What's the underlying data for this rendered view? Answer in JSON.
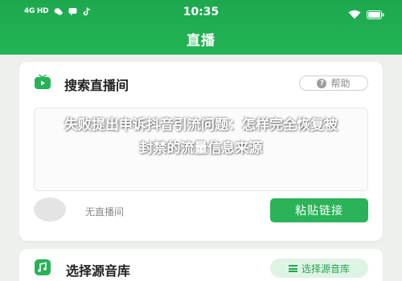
{
  "status_bar": {
    "signal_label": "4G HD",
    "time": "10:35"
  },
  "header": {
    "title": "直播"
  },
  "search_card": {
    "title": "搜索直播间",
    "help_label": "帮助",
    "input_placeholder": "",
    "no_live_label": "无直播间",
    "paste_button_label": "粘贴链接"
  },
  "watermark": {
    "line1": "失败提出申诉抖音引流问题：怎样完全恢复被",
    "line2": "封禁的流量信息来源"
  },
  "source_card": {
    "title": "选择源音库",
    "button_label": "选择源音库"
  },
  "colors": {
    "header_green": "#22b455",
    "button_green": "#2bb359",
    "page_bg": "#eef0ee"
  },
  "icons": {
    "status": [
      "wechat-icon",
      "message-icon",
      "tiktok-icon",
      "wifi-icon",
      "battery-icon"
    ],
    "search_card": "tv-icon",
    "help": "question-icon",
    "source_card": "music-library-icon",
    "source_button": "menu-icon"
  }
}
